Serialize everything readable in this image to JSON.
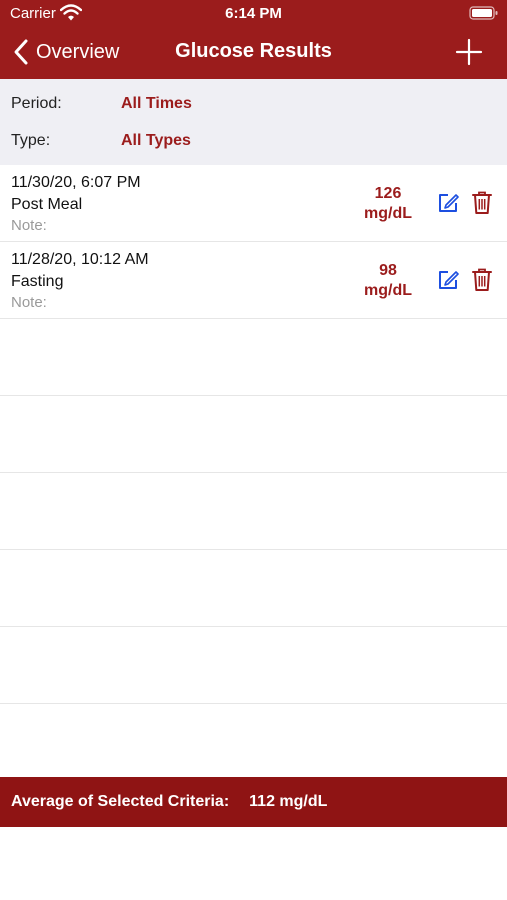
{
  "status": {
    "carrier": "Carrier",
    "time": "6:14 PM"
  },
  "nav": {
    "back_label": "Overview",
    "title": "Glucose Results"
  },
  "filters": {
    "period_label": "Period:",
    "period_value": "All Times",
    "type_label": "Type:",
    "type_value": "All Types"
  },
  "results": [
    {
      "date": "11/30/20, 6:07 PM",
      "type": "Post Meal",
      "note": "Note:",
      "value": "126",
      "unit": "mg/dL"
    },
    {
      "date": "11/28/20, 10:12 AM",
      "type": "Fasting",
      "note": "Note:",
      "value": "98",
      "unit": "mg/dL"
    }
  ],
  "summary": {
    "label": "Average of Selected Criteria:",
    "value": "112 mg/dL"
  },
  "colors": {
    "accent": "#9b1c1c",
    "edit_icon": "#1d4fe0",
    "filter_bg": "#efeff4"
  }
}
